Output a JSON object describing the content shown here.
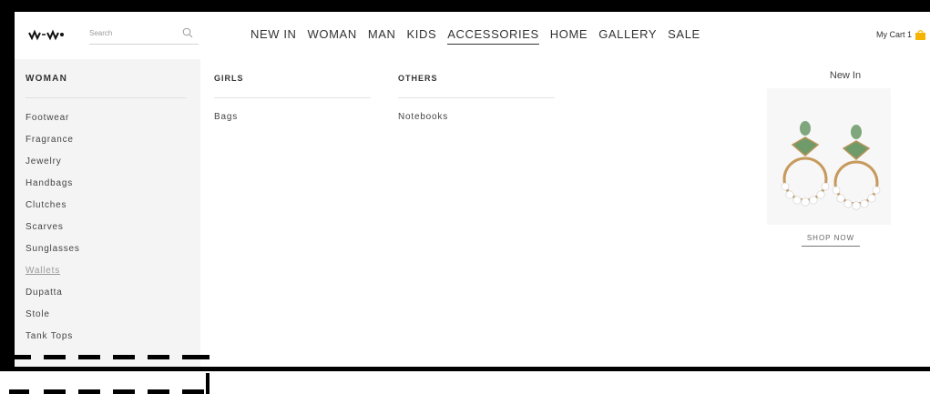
{
  "brand": {
    "logo_icon": "logo-icon"
  },
  "search": {
    "placeholder": "Search",
    "icon": "search-icon"
  },
  "nav": {
    "items": [
      {
        "label": "NEW IN"
      },
      {
        "label": "WOMAN"
      },
      {
        "label": "MAN"
      },
      {
        "label": "KIDS"
      },
      {
        "label": "ACCESSORIES",
        "active": true
      },
      {
        "label": "HOME"
      },
      {
        "label": "GALLERY"
      },
      {
        "label": "SALE"
      }
    ]
  },
  "cart": {
    "label": "My Cart",
    "count": "1",
    "icon": "shopping-bag-icon",
    "icon_color": "#f5b400"
  },
  "sidebar": {
    "heading": "WOMAN",
    "items": [
      {
        "label": "Footwear"
      },
      {
        "label": "Fragrance"
      },
      {
        "label": "Jewelry"
      },
      {
        "label": "Handbags"
      },
      {
        "label": "Clutches"
      },
      {
        "label": "Scarves"
      },
      {
        "label": "Sunglasses"
      },
      {
        "label": "Wallets",
        "muted": true
      },
      {
        "label": "Dupatta"
      },
      {
        "label": "Stole"
      },
      {
        "label": "Tank Tops"
      }
    ]
  },
  "columns": [
    {
      "heading": "GIRLS",
      "links": [
        "Bags"
      ]
    },
    {
      "heading": "OTHERS",
      "links": [
        "Notebooks"
      ]
    }
  ],
  "promo": {
    "title": "New In",
    "cta": "SHOP NOW",
    "image_icon": "earrings-image"
  }
}
